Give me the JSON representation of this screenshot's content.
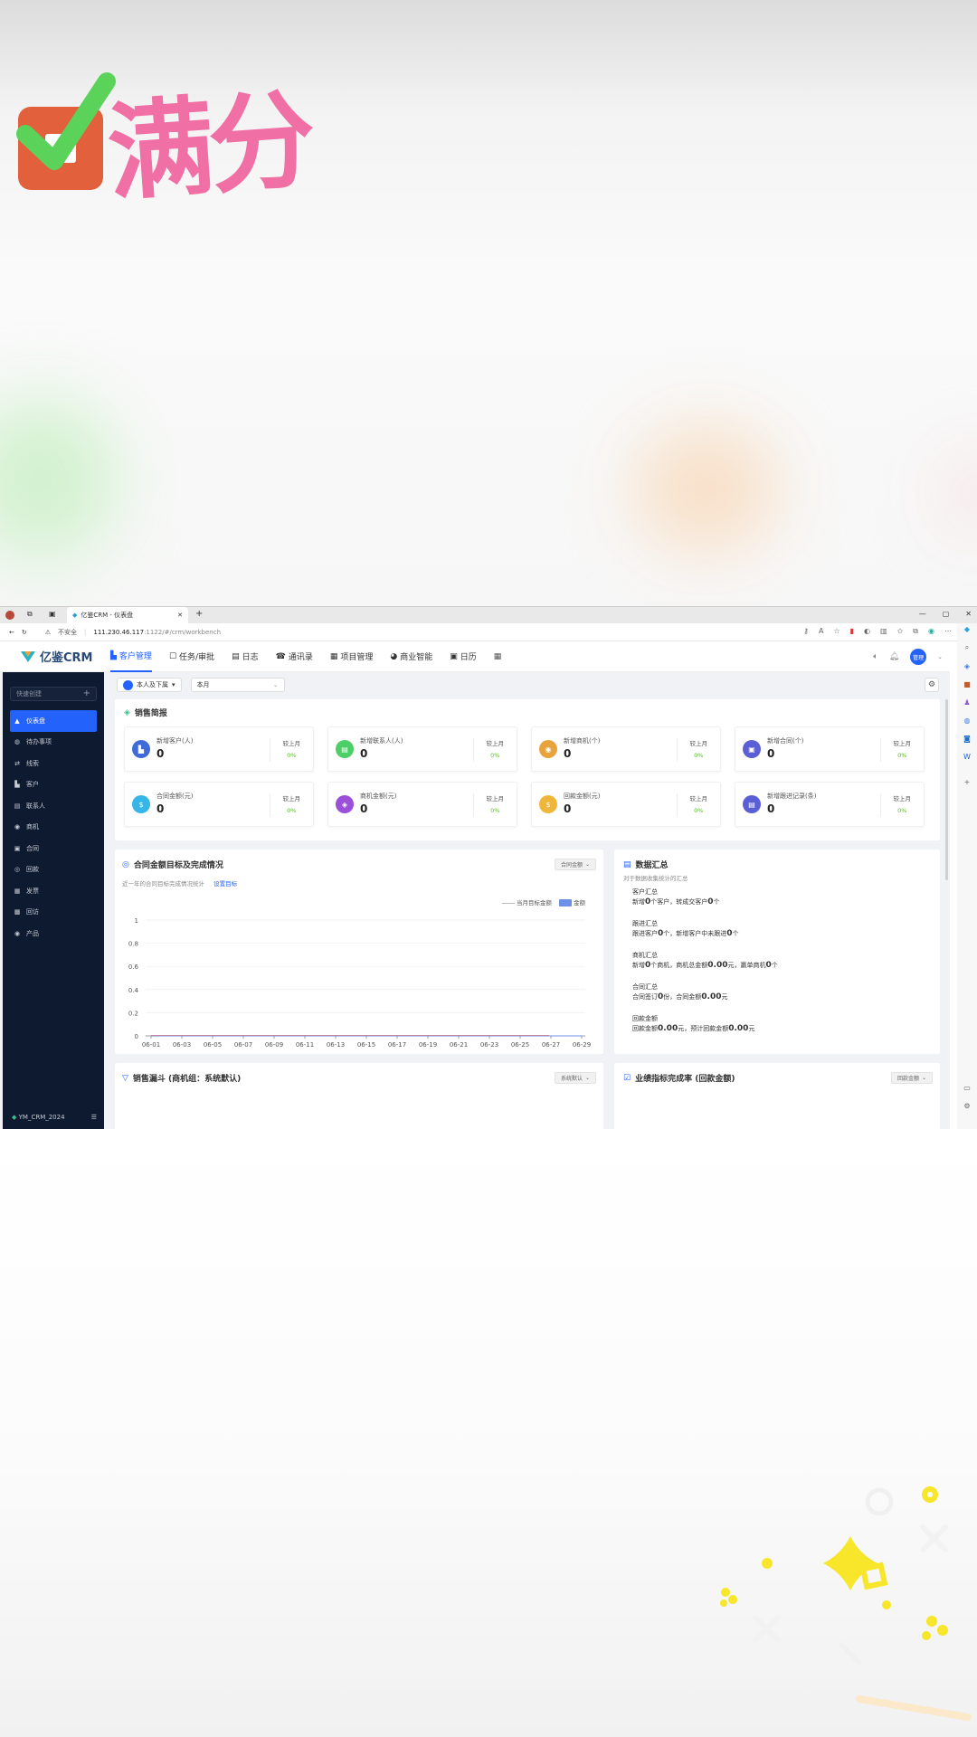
{
  "overlay": {
    "badge_text": "满分"
  },
  "browser": {
    "tab_title": "亿鉴CRM - 仪表盘",
    "new_tab": "+",
    "window_controls": [
      "—",
      "▢",
      "✕"
    ],
    "security": "不安全",
    "url_host": "111.230.46.117",
    "url_path": ":1122/#/crm/workbench"
  },
  "app": {
    "logo": "亿鉴CRM",
    "nav": [
      {
        "label": "客户管理",
        "icon": "customer-icon",
        "active": true
      },
      {
        "label": "任务/审批",
        "icon": "task-icon"
      },
      {
        "label": "日志",
        "icon": "log-icon"
      },
      {
        "label": "通讯录",
        "icon": "contacts-icon"
      },
      {
        "label": "项目管理",
        "icon": "project-icon"
      },
      {
        "label": "商业智能",
        "icon": "bi-icon"
      },
      {
        "label": "日历",
        "icon": "calendar-icon"
      }
    ],
    "user_avatar": "管理",
    "accent": "#2362fb"
  },
  "sidebar": {
    "quick_create": "快速创建",
    "items": [
      {
        "label": "仪表盘",
        "active": true
      },
      {
        "label": "待办事项"
      },
      {
        "label": "线索"
      },
      {
        "label": "客户"
      },
      {
        "label": "联系人"
      },
      {
        "label": "商机"
      },
      {
        "label": "合同"
      },
      {
        "label": "回款"
      },
      {
        "label": "发票"
      },
      {
        "label": "回访"
      },
      {
        "label": "产品"
      }
    ],
    "footer": "YM_CRM_2024"
  },
  "filters": {
    "scope": "本人及下属",
    "period": "本月"
  },
  "sales_brief": {
    "title": "销售简报",
    "compare_label": "较上月",
    "stats": [
      {
        "label": "新增客户(人)",
        "value": "0",
        "pct": "0%",
        "color": "#3f6ad8",
        "icon": "customer-icon"
      },
      {
        "label": "新增联系人(人)",
        "value": "0",
        "pct": "0%",
        "color": "#4ccf67",
        "icon": "contact-icon"
      },
      {
        "label": "新增商机(个)",
        "value": "0",
        "pct": "0%",
        "color": "#e8a33d",
        "icon": "opportunity-icon"
      },
      {
        "label": "新增合同(个)",
        "value": "0",
        "pct": "0%",
        "color": "#5b5fd6",
        "icon": "contract-icon"
      },
      {
        "label": "合同金额(元)",
        "value": "0",
        "pct": "0%",
        "color": "#36b6e6",
        "icon": "money-icon"
      },
      {
        "label": "商机金额(元)",
        "value": "0",
        "pct": "0%",
        "color": "#9c4fd8",
        "icon": "shield-icon"
      },
      {
        "label": "回款金额(元)",
        "value": "0",
        "pct": "0%",
        "color": "#f0b63a",
        "icon": "money-icon"
      },
      {
        "label": "新增跟进记录(条)",
        "value": "0",
        "pct": "0%",
        "color": "#5b5fd6",
        "icon": "note-icon"
      }
    ]
  },
  "contract_target": {
    "title": "合同金额目标及完成情况",
    "dropdown": "合同金额",
    "subtitle": "近一年的合同目标完成情况统计",
    "link": "设置目标",
    "legend_line": "当月目标金额",
    "legend_bar": "金额"
  },
  "chart_data": {
    "type": "line",
    "x": [
      "06-01",
      "06-03",
      "06-05",
      "06-07",
      "06-09",
      "06-11",
      "06-13",
      "06-15",
      "06-17",
      "06-19",
      "06-21",
      "06-23",
      "06-25",
      "06-27",
      "06-29"
    ],
    "series": [
      {
        "name": "当月目标金额",
        "values": [
          0,
          0,
          0,
          0,
          0,
          0,
          0,
          0,
          0,
          0,
          0,
          0,
          0,
          0,
          0
        ]
      },
      {
        "name": "金额",
        "values": [
          0,
          0,
          0,
          0,
          0,
          0,
          0,
          0,
          0,
          0,
          0,
          0,
          0,
          0,
          0
        ]
      }
    ],
    "yticks": [
      "0",
      "0.2",
      "0.4",
      "0.6",
      "0.8",
      "1"
    ],
    "ylim": [
      0,
      1
    ],
    "legend": "top-right",
    "line_color": "#c7c7c7",
    "bar_color": "#6c8fe8"
  },
  "data_summary": {
    "title": "数据汇总",
    "subtitle": "对于数据收集统计的汇总",
    "sections": [
      {
        "heading": "客户汇总",
        "parts": [
          "新增",
          "0",
          "个客户，转成交客户",
          "0",
          "个"
        ]
      },
      {
        "heading": "跟进汇总",
        "parts": [
          "跟进客户",
          "0",
          "个，新增客户中未跟进",
          "0",
          "个"
        ]
      },
      {
        "heading": "商机汇总",
        "parts": [
          "新增",
          "0",
          "个商机，商机总金额",
          "0.00",
          "元，赢单商机",
          "0",
          "个"
        ]
      },
      {
        "heading": "合同汇总",
        "parts": [
          "合同签订",
          "0",
          "份，合同金额",
          "0.00",
          "元"
        ]
      },
      {
        "heading": "回款金额",
        "parts": [
          "回款金额",
          "0.00",
          "元，预计回款金额",
          "0.00",
          "元"
        ]
      }
    ]
  },
  "funnel": {
    "title": "销售漏斗 (商机组：系统默认)",
    "dropdown": "系统默认"
  },
  "performance": {
    "title": "业绩指标完成率 (回款金额)",
    "dropdown": "回款金额"
  }
}
